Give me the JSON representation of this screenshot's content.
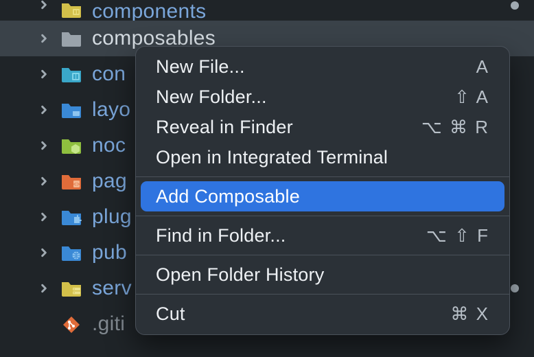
{
  "tree": {
    "items": [
      {
        "label": "components",
        "icon": "components",
        "color": "#d3c04a",
        "selected": false,
        "first": true,
        "dot": true,
        "chevron": true
      },
      {
        "label": "composables",
        "icon": "folder-plain",
        "color": "#9aa3ab",
        "selected": true,
        "dot": false,
        "chevron": true
      },
      {
        "label": "con",
        "icon": "content",
        "color": "#3aa7c9",
        "selected": false,
        "dot": false,
        "chevron": true
      },
      {
        "label": "layo",
        "icon": "layouts",
        "color": "#3a89d6",
        "selected": false,
        "dot": false,
        "chevron": true
      },
      {
        "label": "noc",
        "icon": "node",
        "color": "#8fbf3f",
        "selected": false,
        "dot": false,
        "chevron": true
      },
      {
        "label": "pag",
        "icon": "pages",
        "color": "#e06c3a",
        "selected": false,
        "dot": false,
        "chevron": true
      },
      {
        "label": "plug",
        "icon": "plugins",
        "color": "#3a89d6",
        "selected": false,
        "dot": false,
        "chevron": true
      },
      {
        "label": "pub",
        "icon": "public",
        "color": "#3a89d6",
        "selected": false,
        "dot": false,
        "chevron": true
      },
      {
        "label": "serv",
        "icon": "server",
        "color": "#d3c04a",
        "selected": false,
        "dot": true,
        "chevron": true
      },
      {
        "label": ".giti",
        "icon": "git",
        "color": "#e06c3a",
        "selected": false,
        "dot": false,
        "chevron": false
      }
    ]
  },
  "menu": {
    "items": [
      {
        "label": "New File...",
        "shortcut": "A"
      },
      {
        "label": "New Folder...",
        "shortcut": "⇧ A"
      },
      {
        "label": "Reveal in Finder",
        "shortcut": "⌥ ⌘ R"
      },
      {
        "label": "Open in Integrated Terminal",
        "shortcut": ""
      },
      {
        "sep": true
      },
      {
        "label": "Add Composable",
        "shortcut": "",
        "highlight": true
      },
      {
        "sep": true
      },
      {
        "label": "Find in Folder...",
        "shortcut": "⌥ ⇧ F"
      },
      {
        "sep": true
      },
      {
        "label": "Open Folder History",
        "shortcut": ""
      },
      {
        "sep": true
      },
      {
        "label": "Cut",
        "shortcut": "⌘ X"
      }
    ]
  }
}
